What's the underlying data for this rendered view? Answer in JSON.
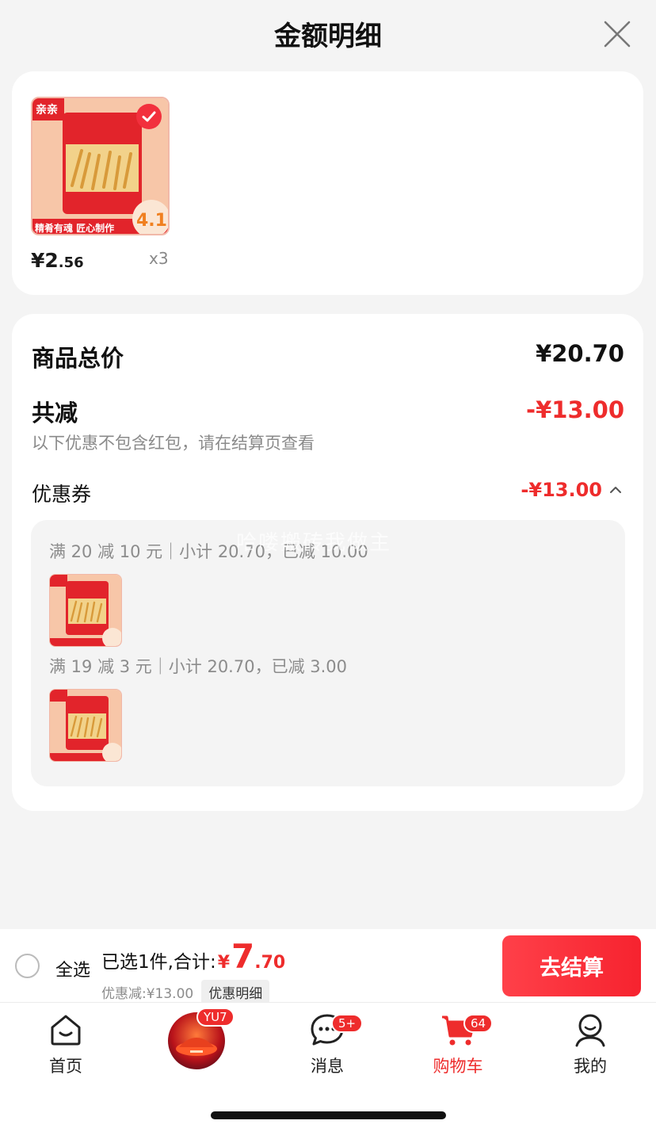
{
  "header": {
    "title": "金额明细"
  },
  "product": {
    "price_int": "¥2",
    "price_dec": ".56",
    "quantity": "x3",
    "thumb_brand": "亲亲",
    "thumb_slogan": "精肴有魂 匠心制作",
    "thumb_tag": "4.1"
  },
  "summary": {
    "total_label": "商品总价",
    "total_value": "¥20.70",
    "reduce_label": "共减",
    "reduce_value": "-¥13.00",
    "note": "以下优惠不包含红包，请在结算页查看",
    "coupon_label": "优惠券",
    "coupon_value": "-¥13.00"
  },
  "coupons": [
    {
      "text": "满 20 减 10 元｜小计 20.70，已减 10.00"
    },
    {
      "text": "满 19 减 3 元｜小计 20.70，已减 3.00"
    }
  ],
  "watermark": "哈喽搬砖我做主",
  "checkout": {
    "select_all": "全选",
    "sum_label": "已选1件,合计:",
    "sum_yen": "¥",
    "sum_int": "7",
    "sum_dec": ".70",
    "discount_text": "优惠减:¥13.00",
    "detail_label": "优惠明细",
    "pay_label": "去结算"
  },
  "tabs": {
    "home": "首页",
    "avatar_badge": "YU7",
    "msg": "消息",
    "msg_badge": "5+",
    "cart": "购物车",
    "cart_badge": "64",
    "me": "我的"
  },
  "colors": {
    "accent": "#ee2c2c",
    "background": "#f4f4f4"
  }
}
